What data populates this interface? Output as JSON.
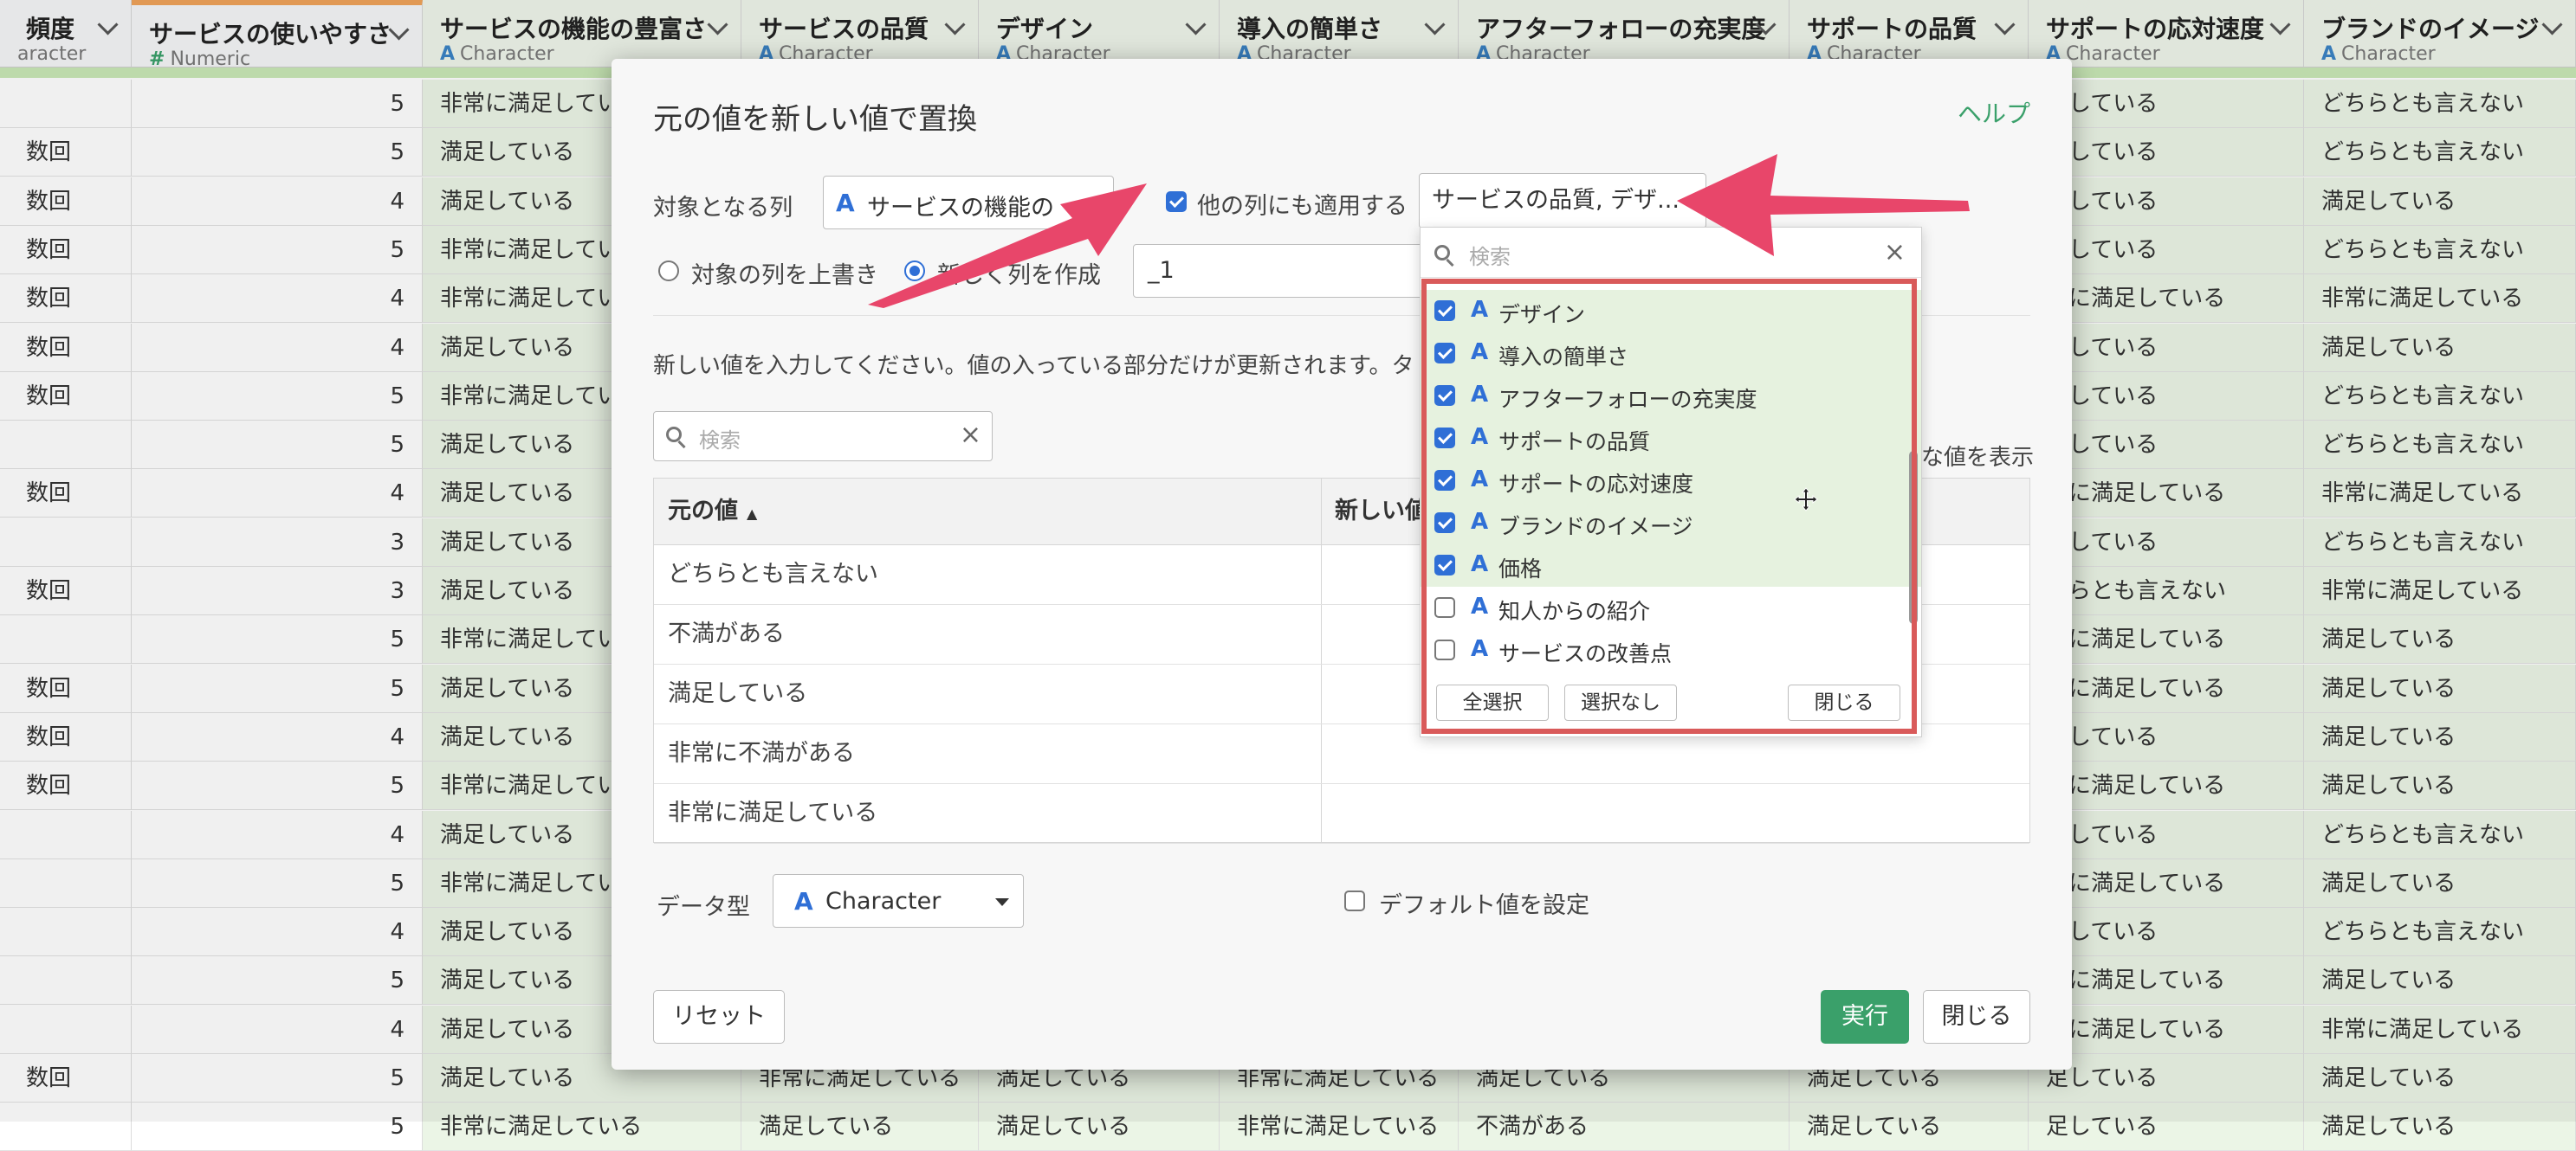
{
  "grid": {
    "columns": [
      {
        "name": "頻度",
        "type": "aracter",
        "type_icon": "",
        "green": false
      },
      {
        "name": "サービスの使いやすさ",
        "type": "Numeric",
        "type_icon": "#",
        "green": false
      },
      {
        "name": "サービスの機能の豊富さ",
        "type": "Character",
        "type_icon": "A",
        "green": true
      },
      {
        "name": "サービスの品質",
        "type": "Character",
        "type_icon": "A",
        "green": true
      },
      {
        "name": "デザイン",
        "type": "Character",
        "type_icon": "A",
        "green": true
      },
      {
        "name": "導入の簡単さ",
        "type": "Character",
        "type_icon": "A",
        "green": true
      },
      {
        "name": "アフターフォローの充実度",
        "type": "Character",
        "type_icon": "A",
        "green": true
      },
      {
        "name": "サポートの品質",
        "type": "Character",
        "type_icon": "A",
        "green": true
      },
      {
        "name": "サポートの応対速度",
        "type": "Character",
        "type_icon": "A",
        "green": true
      },
      {
        "name": "ブランドのイメージ",
        "type": "Character",
        "type_icon": "A",
        "green": true
      }
    ],
    "rows": [
      [
        "",
        "5",
        "非常に満足してい",
        "",
        "",
        "",
        "",
        "",
        "足している",
        "どちらとも言えない"
      ],
      [
        "数回",
        "5",
        "満足している",
        "",
        "",
        "",
        "",
        "",
        "足している",
        "どちらとも言えない"
      ],
      [
        "数回",
        "4",
        "満足している",
        "",
        "",
        "",
        "",
        "",
        "足している",
        "満足している"
      ],
      [
        "数回",
        "5",
        "非常に満足してい",
        "",
        "",
        "",
        "",
        "",
        "足している",
        "どちらとも言えない"
      ],
      [
        "数回",
        "4",
        "非常に満足してい",
        "",
        "",
        "",
        "",
        "",
        "常に満足している",
        "非常に満足している"
      ],
      [
        "数回",
        "4",
        "満足している",
        "",
        "",
        "",
        "",
        "",
        "足している",
        "満足している"
      ],
      [
        "数回",
        "5",
        "非常に満足してい",
        "",
        "",
        "",
        "",
        "",
        "足している",
        "どちらとも言えない"
      ],
      [
        "",
        "5",
        "満足している",
        "",
        "",
        "",
        "",
        "",
        "足している",
        "どちらとも言えない"
      ],
      [
        "数回",
        "4",
        "満足している",
        "",
        "",
        "",
        "",
        "",
        "常に満足している",
        "非常に満足している"
      ],
      [
        "",
        "3",
        "満足している",
        "",
        "",
        "",
        "",
        "",
        "足している",
        "どちらとも言えない"
      ],
      [
        "数回",
        "3",
        "満足している",
        "",
        "",
        "",
        "",
        "",
        "ちらとも言えない",
        "非常に満足している"
      ],
      [
        "",
        "5",
        "非常に満足してい",
        "",
        "",
        "",
        "",
        "",
        "常に満足している",
        "満足している"
      ],
      [
        "数回",
        "5",
        "満足している",
        "",
        "",
        "",
        "",
        "",
        "常に満足している",
        "満足している"
      ],
      [
        "数回",
        "4",
        "満足している",
        "",
        "",
        "",
        "",
        "",
        "足している",
        "満足している"
      ],
      [
        "数回",
        "5",
        "非常に満足してい",
        "",
        "",
        "",
        "",
        "",
        "常に満足している",
        "満足している"
      ],
      [
        "",
        "4",
        "満足している",
        "",
        "",
        "",
        "",
        "",
        "足している",
        "どちらとも言えない"
      ],
      [
        "",
        "5",
        "非常に満足してい",
        "",
        "",
        "",
        "",
        "",
        "常に満足している",
        "満足している"
      ],
      [
        "",
        "4",
        "満足している",
        "",
        "",
        "",
        "",
        "",
        "足している",
        "どちらとも言えない"
      ],
      [
        "",
        "5",
        "満足している",
        "",
        "",
        "",
        "",
        "",
        "常に満足している",
        "満足している"
      ],
      [
        "",
        "4",
        "満足している",
        "",
        "",
        "",
        "",
        "",
        "常に満足している",
        "非常に満足している"
      ],
      [
        "数回",
        "5",
        "満足している",
        "非常に満足している",
        "満足している",
        "非常に満足している",
        "満足している",
        "満足している",
        "足している",
        "満足している"
      ],
      [
        "",
        "5",
        "非常に満足している",
        "満足している",
        "満足している",
        "非常に満足している",
        "不満がある",
        "満足している",
        "足している",
        "満足している"
      ]
    ]
  },
  "dialog": {
    "title": "元の値を新しい値で置換",
    "help": "ヘルプ",
    "target_column_label": "対象となる列",
    "target_column_value": "サービスの機能の",
    "apply_other_label": "他の列にも適用する",
    "apply_other_checked": true,
    "other_columns_value": "サービスの品質, デザ...",
    "overwrite_label": "対象の列を上書き",
    "new_column_label": "新しく列を作成",
    "new_column_selected": true,
    "suffix_value": "_1",
    "instruction": "新しい値を入力してください。値の入っている部分だけが更新されます。タ",
    "search_placeholder": "検索",
    "show_all_label": "な値を表示",
    "table_headers": {
      "original": "元の値",
      "new": "新しい値"
    },
    "table_rows": [
      "どちらとも言えない",
      "不満がある",
      "満足している",
      "非常に不満がある",
      "非常に満足している"
    ],
    "data_type_label": "データ型",
    "data_type_value": "Character",
    "default_value_label": "デフォルト値を設定",
    "reset_label": "リセット",
    "run_label": "実行",
    "close_label": "閉じる"
  },
  "dropdown": {
    "search_placeholder": "検索",
    "items": [
      {
        "label": "デザイン",
        "checked": true
      },
      {
        "label": "導入の簡単さ",
        "checked": true
      },
      {
        "label": "アフターフォローの充実度",
        "checked": true
      },
      {
        "label": "サポートの品質",
        "checked": true
      },
      {
        "label": "サポートの応対速度",
        "checked": true
      },
      {
        "label": "ブランドのイメージ",
        "checked": true
      },
      {
        "label": "価格",
        "checked": true
      },
      {
        "label": "知人からの紹介",
        "checked": false
      },
      {
        "label": "サービスの改善点",
        "checked": false
      }
    ],
    "select_all": "全選択",
    "select_none": "選択なし",
    "close": "閉じる"
  },
  "annotation": {
    "arrow_color": "#e8466a",
    "highlight_color": "#d95a5a"
  }
}
